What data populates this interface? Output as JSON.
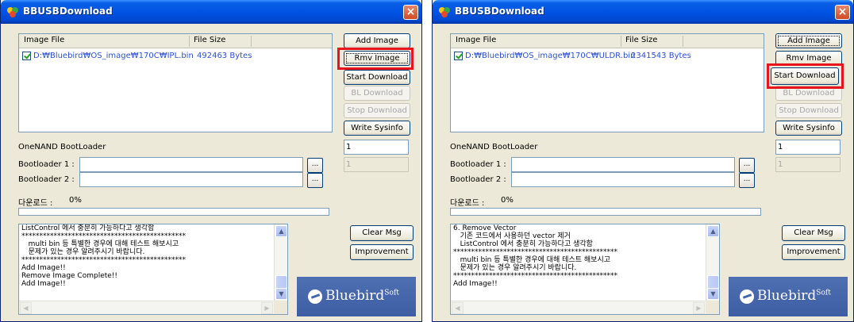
{
  "windows": [
    {
      "title": "BBUSBDownload",
      "close": "×",
      "list": {
        "col_image_file": "Image File",
        "col_file_size": "File Size",
        "row_path": "D:₩Bluebird₩OS_image₩170C₩IPL.bin",
        "row_size": "492463 Bytes"
      },
      "buttons": {
        "add_image": "Add Image",
        "rmv_image": "Rmv Image",
        "start_download": "Start Download",
        "bl_download": "BL Download",
        "stop_download": "Stop Download",
        "write_sysinfo": "Write Sysinfo",
        "clear_msg": "Clear Msg",
        "improvement": "Improvement",
        "browse": "..."
      },
      "sysinfo_value_1": "1",
      "sysinfo_value_2": "1",
      "onenand_label": "OneNAND BootLoader",
      "bootloader1_label": "Bootloader 1 :",
      "bootloader2_label": "Bootloader 2 :",
      "download_label": "다운로드 :",
      "download_percent": "0%",
      "download_progress": 0,
      "messages": [
        "ListControl 에서 충분히 가능하다고 생각함",
        "**********************************************",
        "   multi bin 등 특별한 경우에 대해 테스트 해보시고",
        "   문제가 있는 경우 알려주시기 바랍니다.",
        "**********************************************",
        "Add Image!!",
        "Remove Image Complete!!",
        "Add Image!!"
      ],
      "logo_text": "Bluebird",
      "logo_sup": "Soft",
      "highlighted_button": "rmv_image"
    },
    {
      "title": "BBUSBDownload",
      "close": "×",
      "list": {
        "col_image_file": "Image File",
        "col_file_size": "File Size",
        "row_path": "D:₩Bluebird₩OS_image₩170C₩ULDR.bin",
        "row_size": "2341543 Bytes"
      },
      "buttons": {
        "add_image": "Add Image",
        "rmv_image": "Rmv Image",
        "start_download": "Start Download",
        "bl_download": "BL Download",
        "stop_download": "Stop Download",
        "write_sysinfo": "Write Sysinfo",
        "clear_msg": "Clear Msg",
        "improvement": "Improvement",
        "browse": "..."
      },
      "sysinfo_value_1": "1",
      "sysinfo_value_2": "1",
      "onenand_label": "OneNAND BootLoader",
      "bootloader1_label": "Bootloader 1 :",
      "bootloader2_label": "Bootloader 2 :",
      "download_label": "다운로드 :",
      "download_percent": "0%",
      "download_progress": 0,
      "messages": [
        "6. Remove Vector",
        "   기존 코드에서 사용하던 vector 제거",
        "   ListControl 에서 충분히 가능하다고 생각함",
        "**********************************************",
        "   multi bin 등 특별한 경우에 대해 테스트 해보시고",
        "   문제가 있는 경우 알려주시기 바랍니다.",
        "**********************************************",
        "Add Image!!"
      ],
      "logo_text": "Bluebird",
      "logo_sup": "Soft",
      "highlighted_button": "start_download"
    }
  ],
  "colors": {
    "titlebar": "#0054e3",
    "highlight": "#e8141c",
    "link_text": "#2b4fd1",
    "logo_bg": "#4565ab"
  }
}
